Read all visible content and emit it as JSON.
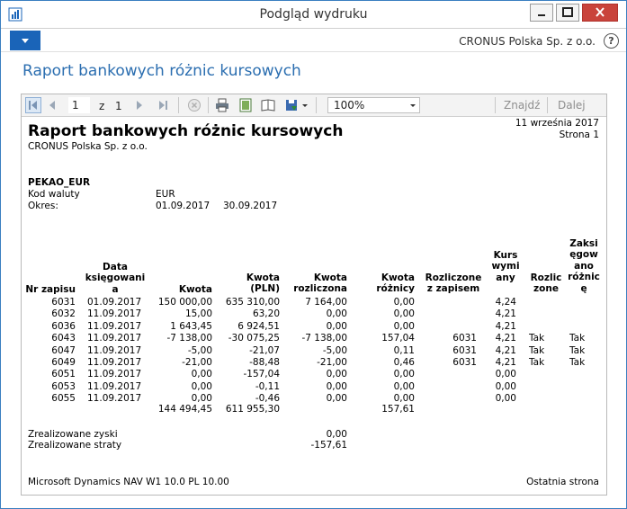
{
  "window": {
    "title": "Podgląd wydruku",
    "company": "CRONUS Polska Sp. z o.o.",
    "help_label": "?"
  },
  "page": {
    "title": "Raport bankowych różnic kursowych"
  },
  "toolbar": {
    "current_page": "1",
    "of_label": "z",
    "total_pages": "1",
    "zoom": "100%",
    "find_label": "Znajdź",
    "next_label": "Dalej"
  },
  "report": {
    "title": "Raport bankowych różnic kursowych",
    "company": "CRONUS Polska Sp. z o.o.",
    "date": "11 września 2017",
    "page_label": "Strona 1",
    "account": "PEKAO_EUR",
    "currency_label": "Kod waluty",
    "currency_value": "EUR",
    "period_label": "Okres:",
    "period_from": "01.09.2017",
    "period_to": "30.09.2017",
    "columns": {
      "nr": "Nr zapisu",
      "date": "Data\nksięgowani\na",
      "amount": "Kwota",
      "amount_pln": "Kwota\n(PLN)",
      "settled_amount": "Kwota\nrozliczona",
      "diff_amount": "Kwota\nróżnicy",
      "settled_with": "Rozliczone\nz zapisem",
      "rate": "Kurs\nwymi\nany",
      "settled": "Rozlic\nzone",
      "posted": "Zaksi\nęgow\nano\nróżnic\nę"
    },
    "rows": [
      {
        "nr": "6031",
        "date": "01.09.2017",
        "amount": "150 000,00",
        "amount_pln": "635 310,00",
        "settled_amount": "7 164,00",
        "diff": "0,00",
        "settled_with": "",
        "rate": "4,24",
        "settled": "",
        "posted": ""
      },
      {
        "nr": "6032",
        "date": "11.09.2017",
        "amount": "15,00",
        "amount_pln": "63,20",
        "settled_amount": "0,00",
        "diff": "0,00",
        "settled_with": "",
        "rate": "4,21",
        "settled": "",
        "posted": ""
      },
      {
        "nr": "6036",
        "date": "11.09.2017",
        "amount": "1 643,45",
        "amount_pln": "6 924,51",
        "settled_amount": "0,00",
        "diff": "0,00",
        "settled_with": "",
        "rate": "4,21",
        "settled": "",
        "posted": ""
      },
      {
        "nr": "6043",
        "date": "11.09.2017",
        "amount": "-7 138,00",
        "amount_pln": "-30 075,25",
        "settled_amount": "-7 138,00",
        "diff": "157,04",
        "settled_with": "6031",
        "rate": "4,21",
        "settled": "Tak",
        "posted": "Tak"
      },
      {
        "nr": "6047",
        "date": "11.09.2017",
        "amount": "-5,00",
        "amount_pln": "-21,07",
        "settled_amount": "-5,00",
        "diff": "0,11",
        "settled_with": "6031",
        "rate": "4,21",
        "settled": "Tak",
        "posted": "Tak"
      },
      {
        "nr": "6049",
        "date": "11.09.2017",
        "amount": "-21,00",
        "amount_pln": "-88,48",
        "settled_amount": "-21,00",
        "diff": "0,46",
        "settled_with": "6031",
        "rate": "4,21",
        "settled": "Tak",
        "posted": "Tak"
      },
      {
        "nr": "6051",
        "date": "11.09.2017",
        "amount": "0,00",
        "amount_pln": "-157,04",
        "settled_amount": "0,00",
        "diff": "0,00",
        "settled_with": "",
        "rate": "0,00",
        "settled": "",
        "posted": ""
      },
      {
        "nr": "6053",
        "date": "11.09.2017",
        "amount": "0,00",
        "amount_pln": "-0,11",
        "settled_amount": "0,00",
        "diff": "0,00",
        "settled_with": "",
        "rate": "0,00",
        "settled": "",
        "posted": ""
      },
      {
        "nr": "6055",
        "date": "11.09.2017",
        "amount": "0,00",
        "amount_pln": "-0,46",
        "settled_amount": "0,00",
        "diff": "0,00",
        "settled_with": "",
        "rate": "0,00",
        "settled": "",
        "posted": ""
      }
    ],
    "totals": {
      "amount": "144 494,45",
      "amount_pln": "611 955,30",
      "diff": "157,61"
    },
    "realized_gains_label": "Zrealizowane zyski",
    "realized_gains_value": "0,00",
    "realized_losses_label": "Zrealizowane straty",
    "realized_losses_value": "-157,61",
    "footer_left": "Microsoft Dynamics NAV W1 10.0  PL 10.00",
    "footer_right": "Ostatnia strona"
  }
}
